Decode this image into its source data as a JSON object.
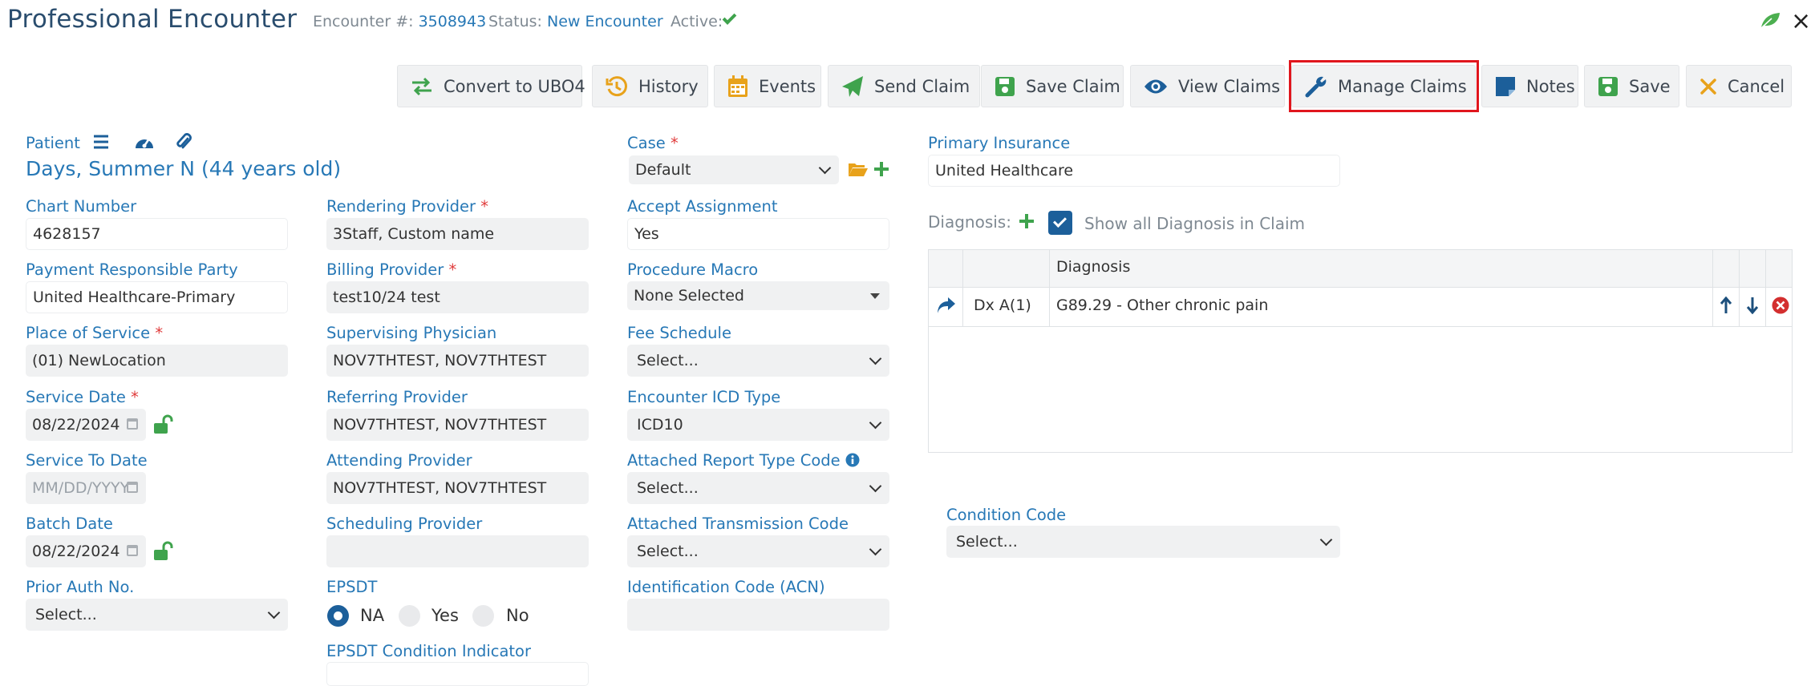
{
  "header": {
    "title": "Professional Encounter",
    "encounter_label": "Encounter #:",
    "encounter_number": "3508943",
    "status_label": "Status:",
    "status_value": "New Encounter",
    "active_label": "Active:"
  },
  "toolbar": {
    "convert": "Convert to UBO4",
    "history": "History",
    "events": "Events",
    "send_claim": "Send Claim",
    "save_claim": "Save Claim",
    "view_claims": "View Claims",
    "manage_claims": "Manage Claims",
    "notes": "Notes",
    "save": "Save",
    "cancel": "Cancel"
  },
  "patient": {
    "label": "Patient",
    "name": "Days, Summer N (44 years old)"
  },
  "col1": {
    "chart_number_label": "Chart Number",
    "chart_number": "4628157",
    "payment_party_label": "Payment Responsible Party",
    "payment_party": "United Healthcare-Primary",
    "place_of_service_label": "Place of Service",
    "place_of_service": "(01) NewLocation",
    "service_date_label": "Service Date",
    "service_date": "08/22/2024",
    "service_to_date_label": "Service To Date",
    "service_to_date_placeholder": "MM/DD/YYYY",
    "batch_date_label": "Batch Date",
    "batch_date": "08/22/2024",
    "prior_auth_label": "Prior Auth No.",
    "prior_auth": "Select..."
  },
  "col2": {
    "rendering_label": "Rendering Provider",
    "rendering": "3Staff, Custom name",
    "billing_label": "Billing Provider",
    "billing": "test10/24 test",
    "supervising_label": "Supervising Physician",
    "supervising": "NOV7THTEST, NOV7THTEST",
    "referring_label": "Referring Provider",
    "referring": "NOV7THTEST, NOV7THTEST",
    "attending_label": "Attending Provider",
    "attending": "NOV7THTEST, NOV7THTEST",
    "scheduling_label": "Scheduling Provider",
    "scheduling": "",
    "epsdt_label": "EPSDT",
    "epsdt_options": [
      "NA",
      "Yes",
      "No"
    ],
    "epsdt_selected": "NA",
    "epsdt_condition_label": "EPSDT Condition Indicator"
  },
  "col3": {
    "case_label": "Case",
    "case": "Default",
    "accept_label": "Accept Assignment",
    "accept": "Yes",
    "macro_label": "Procedure Macro",
    "macro": "None Selected",
    "fee_label": "Fee Schedule",
    "fee": "Select...",
    "icd_type_label": "Encounter ICD Type",
    "icd_type": "ICD10",
    "report_type_label": "Attached Report Type Code",
    "report_type": "Select...",
    "transmission_label": "Attached Transmission Code",
    "transmission": "Select...",
    "acn_label": "Identification Code (ACN)",
    "acn": ""
  },
  "col4": {
    "primary_ins_label": "Primary Insurance",
    "primary_ins": "United Healthcare",
    "diagnosis_label": "Diagnosis:",
    "show_all_label": "Show all Diagnosis in Claim",
    "condition_code_label": "Condition Code",
    "condition_code": "Select..."
  },
  "diagnosis_grid": {
    "header": "Diagnosis",
    "rows": [
      {
        "code_ref": "Dx A(1)",
        "diagnosis": "G89.29 - Other chronic pain"
      }
    ]
  },
  "colors": {
    "accent": "#2778b6",
    "title": "#2a4d6e",
    "green": "#3fa34d",
    "highlight": "#e0161d"
  }
}
